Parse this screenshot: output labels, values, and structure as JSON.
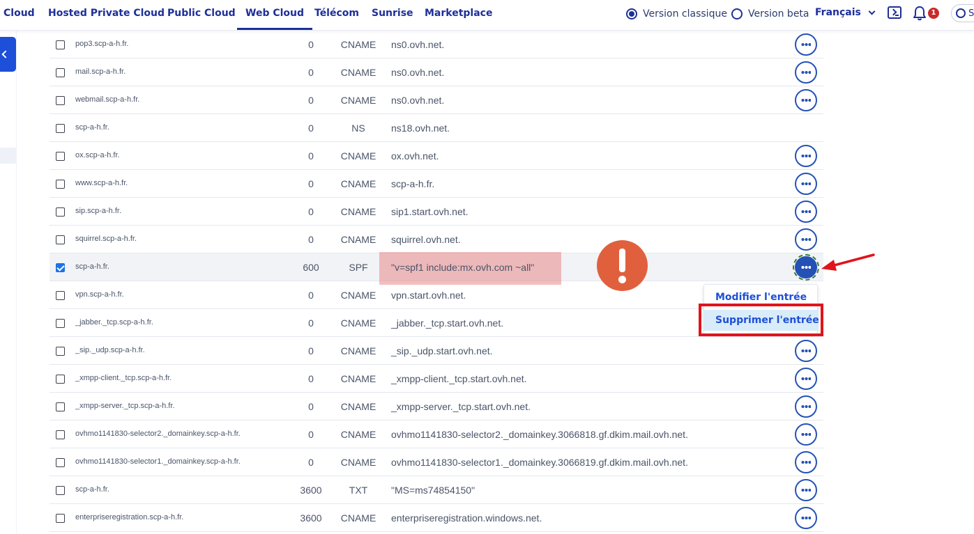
{
  "nav": {
    "links": [
      "Cloud",
      "Hosted Private Cloud",
      "Public Cloud",
      "Web Cloud",
      "Télécom",
      "Sunrise",
      "Marketplace"
    ],
    "version_classic": "Version classique",
    "version_beta": "Version beta",
    "language": "Français",
    "notification_count": "1",
    "account_initial": "S"
  },
  "records": [
    {
      "domain": "pop3.scp-a-h.fr.",
      "ttl": "0",
      "type": "CNAME",
      "target": "ns0.ovh.net."
    },
    {
      "domain": "mail.scp-a-h.fr.",
      "ttl": "0",
      "type": "CNAME",
      "target": "ns0.ovh.net."
    },
    {
      "domain": "webmail.scp-a-h.fr.",
      "ttl": "0",
      "type": "CNAME",
      "target": "ns0.ovh.net."
    },
    {
      "domain": "scp-a-h.fr.",
      "ttl": "0",
      "type": "NS",
      "target": "ns18.ovh.net."
    },
    {
      "domain": "ox.scp-a-h.fr.",
      "ttl": "0",
      "type": "CNAME",
      "target": "ox.ovh.net."
    },
    {
      "domain": "www.scp-a-h.fr.",
      "ttl": "0",
      "type": "CNAME",
      "target": "scp-a-h.fr."
    },
    {
      "domain": "sip.scp-a-h.fr.",
      "ttl": "0",
      "type": "CNAME",
      "target": "sip1.start.ovh.net."
    },
    {
      "domain": "squirrel.scp-a-h.fr.",
      "ttl": "0",
      "type": "CNAME",
      "target": "squirrel.ovh.net."
    },
    {
      "domain": "scp-a-h.fr.",
      "ttl": "600",
      "type": "SPF",
      "target": "\"v=spf1 include:mx.ovh.com ~all\""
    },
    {
      "domain": "vpn.scp-a-h.fr.",
      "ttl": "0",
      "type": "CNAME",
      "target": "vpn.start.ovh.net."
    },
    {
      "domain": "_jabber._tcp.scp-a-h.fr.",
      "ttl": "0",
      "type": "CNAME",
      "target": "_jabber._tcp.start.ovh.net."
    },
    {
      "domain": "_sip._udp.scp-a-h.fr.",
      "ttl": "0",
      "type": "CNAME",
      "target": "_sip._udp.start.ovh.net."
    },
    {
      "domain": "_xmpp-client._tcp.scp-a-h.fr.",
      "ttl": "0",
      "type": "CNAME",
      "target": "_xmpp-client._tcp.start.ovh.net."
    },
    {
      "domain": "_xmpp-server._tcp.scp-a-h.fr.",
      "ttl": "0",
      "type": "CNAME",
      "target": "_xmpp-server._tcp.start.ovh.net."
    },
    {
      "domain": "ovhmo1141830-selector2._domainkey.scp-a-h.fr.",
      "ttl": "0",
      "type": "CNAME",
      "target": "ovhmo1141830-selector2._domainkey.3066818.gf.dkim.mail.ovh.net."
    },
    {
      "domain": "ovhmo1141830-selector1._domainkey.scp-a-h.fr.",
      "ttl": "0",
      "type": "CNAME",
      "target": "ovhmo1141830-selector1._domainkey.3066819.gf.dkim.mail.ovh.net."
    },
    {
      "domain": "scp-a-h.fr.",
      "ttl": "3600",
      "type": "TXT",
      "target": "\"MS=ms74854150\""
    },
    {
      "domain": "enterpriseregistration.scp-a-h.fr.",
      "ttl": "3600",
      "type": "CNAME",
      "target": "enterpriseregistration.windows.net."
    }
  ],
  "menu": {
    "edit_label": "Modifier l'entrée",
    "delete_label": "Supprimer l'entrée"
  },
  "colors": {
    "accent": "#1d2f99",
    "button": "#2451b5",
    "highlight": "#e77171",
    "warning": "#e0603e",
    "annotation": "#e0141a"
  }
}
